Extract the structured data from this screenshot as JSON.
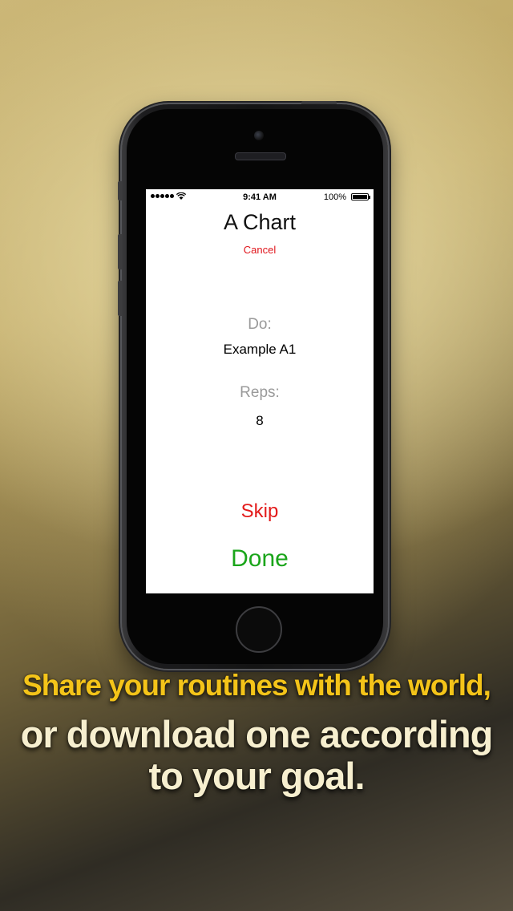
{
  "status_bar": {
    "time": "9:41 AM",
    "battery": "100%"
  },
  "screen": {
    "title": "A Chart",
    "cancel_label": "Cancel",
    "do_label": "Do:",
    "do_value": "Example A1",
    "reps_label": "Reps:",
    "reps_value": "8",
    "skip_label": "Skip",
    "done_label": "Done"
  },
  "caption": {
    "line1": "Share your routines with the world,",
    "line2": "or download one according",
    "line3": "to your goal."
  },
  "colors": {
    "cancel": "#e0151b",
    "skip": "#e31b1b",
    "done": "#1aa51a",
    "caption_highlight": "#f4c419",
    "caption_text": "#f7efcf"
  },
  "icons": [
    "signal-icon",
    "wifi-icon",
    "battery-icon"
  ]
}
